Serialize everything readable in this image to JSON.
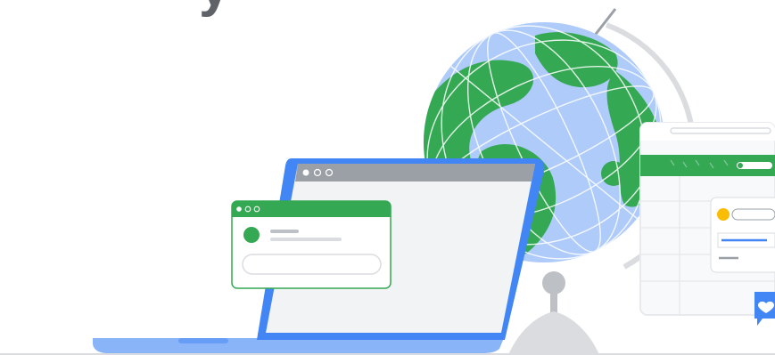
{
  "hero": {
    "headline_fragment": "y",
    "illustration": "globe-laptop-sheets-illustration"
  },
  "laptop": {
    "titlebar_dots": 3,
    "popup": {
      "titlebar_color": "#34a853",
      "avatar_color": "#34a853"
    }
  },
  "sheet_panel": {
    "accent": "#34a853",
    "highlight": "#fbbc04",
    "selection": "#4285f4"
  },
  "chat_badge": {
    "icon": "heart-chat-icon",
    "color": "#4285f4"
  },
  "colors": {
    "ocean": "#aecbfa",
    "land": "#34a853",
    "laptop_frame": "#4285f4",
    "laptop_base": "#8ab4f8",
    "titlebar_gray": "#9aa0a6",
    "screen_bg": "#f1f3f4",
    "stand": "#bdc1c6"
  }
}
